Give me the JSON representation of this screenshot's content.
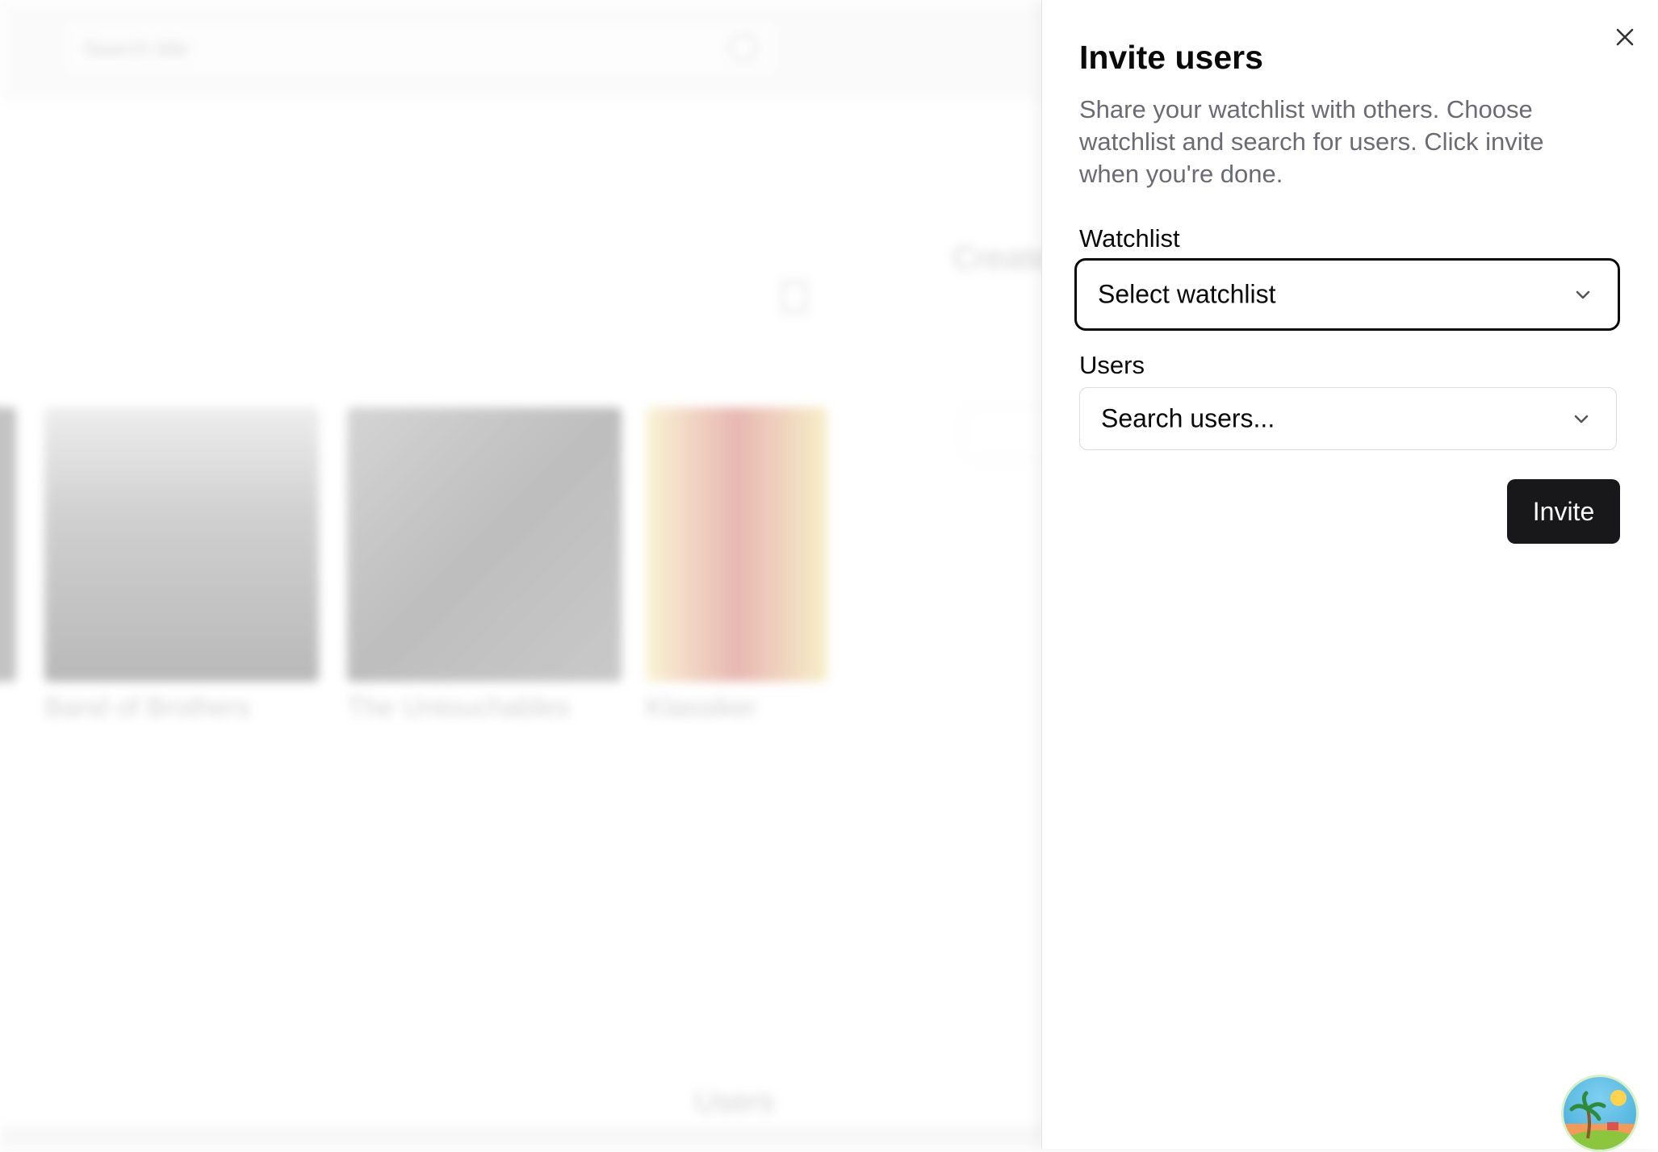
{
  "background": {
    "search_placeholder": "Search title",
    "right_panel_title": "Create",
    "posters": [
      {
        "title": "Band of Brothers"
      },
      {
        "title": "The Untouchables"
      },
      {
        "title": "Klassiker"
      }
    ],
    "bottom_title": "Users"
  },
  "sheet": {
    "title": "Invite users",
    "description": "Share your watchlist with others. Choose watchlist and search for users. Click invite when you're done.",
    "watchlist_label": "Watchlist",
    "watchlist_value": "Select watchlist",
    "users_label": "Users",
    "users_value": "Search users...",
    "invite_label": "Invite",
    "close_icon": "close-icon"
  },
  "colors": {
    "primary_button": "#18181b",
    "focus_ring": "#0a0a0a",
    "muted_text": "#6b6b73"
  }
}
